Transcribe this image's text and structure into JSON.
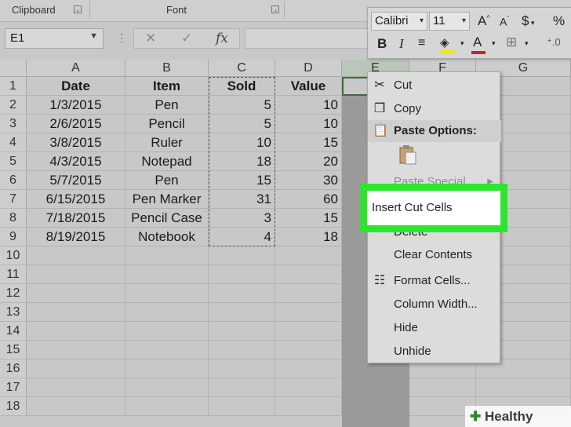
{
  "ribbon": {
    "clipboard_label": "Clipboard",
    "font_label": "Font"
  },
  "formula_bar": {
    "name_box": "E1",
    "cancel_symbol": "✕",
    "enter_symbol": "✓",
    "fx_symbol": "fx"
  },
  "columns": [
    "A",
    "B",
    "C",
    "D",
    "E",
    "F",
    "G"
  ],
  "rows": [
    "1",
    "2",
    "3",
    "4",
    "5",
    "6",
    "7",
    "8",
    "9",
    "10",
    "11",
    "12",
    "13",
    "14",
    "15",
    "16",
    "17",
    "18"
  ],
  "table": {
    "headers": [
      "Date",
      "Item",
      "Sold",
      "Value"
    ],
    "data": [
      [
        "1/3/2015",
        "Pen",
        "5",
        "10"
      ],
      [
        "2/6/2015",
        "Pencil",
        "5",
        "10"
      ],
      [
        "3/8/2015",
        "Ruler",
        "10",
        "15"
      ],
      [
        "4/3/2015",
        "Notepad",
        "18",
        "20"
      ],
      [
        "5/7/2015",
        "Pen",
        "15",
        "30"
      ],
      [
        "6/15/2015",
        "Pen Marker",
        "31",
        "60"
      ],
      [
        "7/18/2015",
        "Pencil Case",
        "3",
        "15"
      ],
      [
        "8/19/2015",
        "Notebook",
        "4",
        "18"
      ]
    ]
  },
  "mini_toolbar": {
    "font_name": "Calibri",
    "font_size": "11",
    "grow_font": "A",
    "shrink_font": "A",
    "currency": "$",
    "percent": "%",
    "bold": "B",
    "italic": "I",
    "font_color_letter": "A"
  },
  "context_menu": {
    "cut": "Cut",
    "copy": "Copy",
    "paste_options": "Paste Options:",
    "paste_special": "Paste Special",
    "insert_cut_cells": "Insert Cut Cells",
    "delete": "Delete",
    "clear_contents": "Clear Contents",
    "format_cells": "Format Cells...",
    "column_width": "Column Width...",
    "hide": "Hide",
    "unhide": "Unhide"
  },
  "watermark": "Healthy Living",
  "colors": {
    "highlight": "#2ee52e",
    "selection_border": "#3c6b3c",
    "font_color_bar": "#d21f1f"
  }
}
